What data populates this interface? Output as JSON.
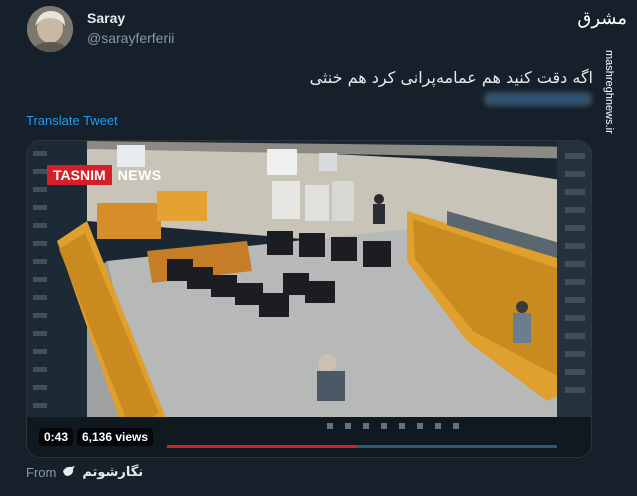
{
  "author": {
    "display_name": "Saray",
    "handle": "@sarayferferii"
  },
  "watermark": {
    "logo": "مشرق",
    "url": "mashreghnews.ir"
  },
  "tweet": {
    "text": "اگه دقت کنید هم عمامه‌پرانی کرد هم خنثی",
    "translate_label": "Translate Tweet"
  },
  "video": {
    "channel_brand_a": "TASNIM",
    "channel_brand_b": "NEWS",
    "duration": "0:43",
    "views": "6,136 views"
  },
  "source": {
    "from_label": "From",
    "icon": "checkmark-bird-icon",
    "name": "نگارشوتم"
  },
  "colors": {
    "background": "#15202b",
    "link": "#1d9bf0",
    "brand_red": "#d4202a"
  }
}
